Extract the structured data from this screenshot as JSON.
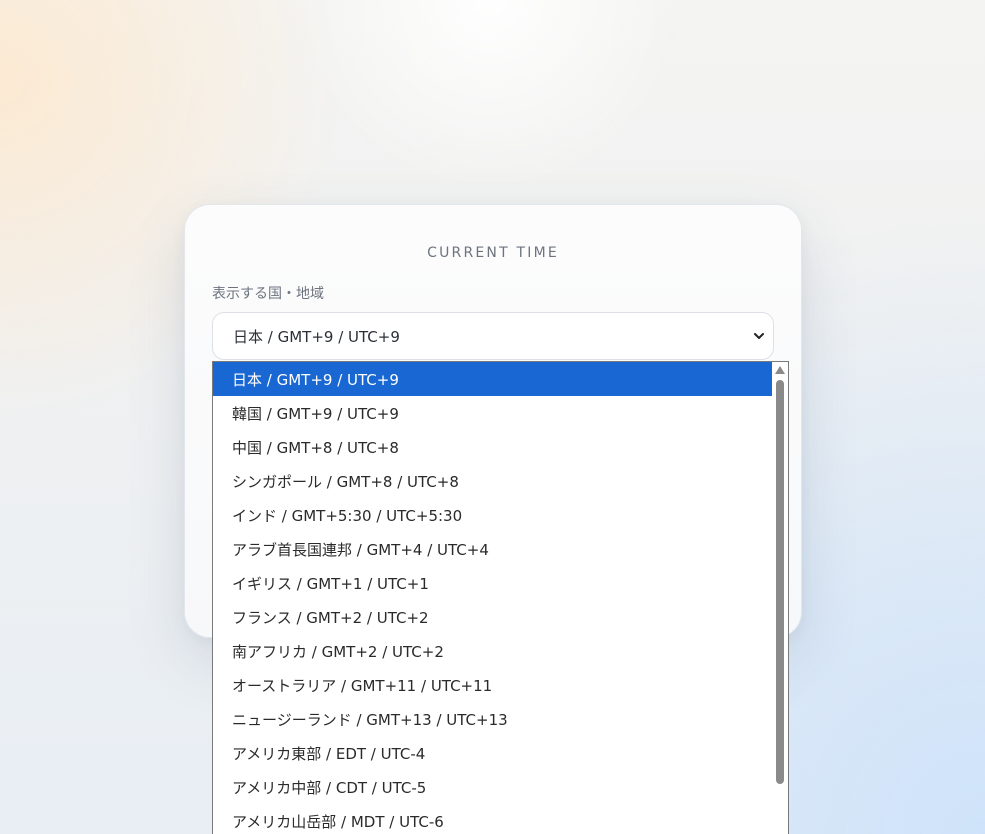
{
  "card": {
    "title": "CURRENT TIME",
    "field_label": "表示する国・地域"
  },
  "select": {
    "value": "日本 / GMT+9 / UTC+9",
    "selected_index": 0
  },
  "options": [
    {
      "label": "日本 / GMT+9 / UTC+9"
    },
    {
      "label": "韓国 / GMT+9 / UTC+9"
    },
    {
      "label": "中国 / GMT+8 / UTC+8"
    },
    {
      "label": "シンガポール / GMT+8 / UTC+8"
    },
    {
      "label": "インド / GMT+5:30 / UTC+5:30"
    },
    {
      "label": "アラブ首長国連邦 / GMT+4 / UTC+4"
    },
    {
      "label": "イギリス / GMT+1 / UTC+1"
    },
    {
      "label": "フランス / GMT+2 / UTC+2"
    },
    {
      "label": "南アフリカ / GMT+2 / UTC+2"
    },
    {
      "label": "オーストラリア / GMT+11 / UTC+11"
    },
    {
      "label": "ニュージーランド / GMT+13 / UTC+13"
    },
    {
      "label": "アメリカ東部 / EDT / UTC-4"
    },
    {
      "label": "アメリカ中部 / CDT / UTC-5"
    },
    {
      "label": "アメリカ山岳部 / MDT / UTC-6"
    }
  ],
  "icons": {
    "select_chevron": "chevron-down-icon",
    "scroll_up": "scroll-up-arrow-icon"
  },
  "colors": {
    "selected_option_bg": "#1967d2",
    "selected_option_text": "#ffffff"
  }
}
